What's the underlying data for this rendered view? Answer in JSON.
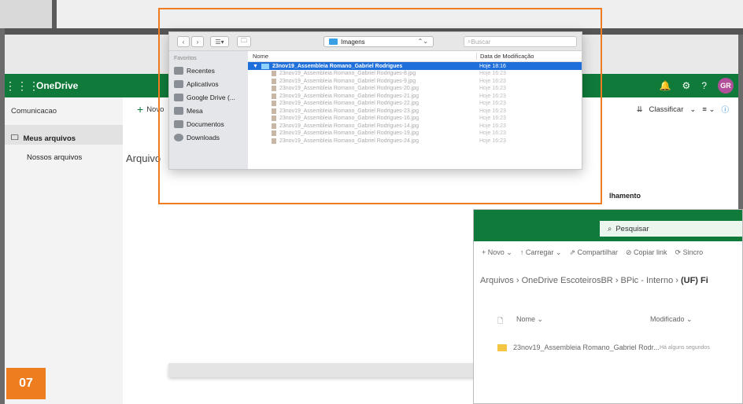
{
  "onedrive": {
    "brand": "OneDrive",
    "avatar_initials": "GR",
    "sidebar": {
      "title": "Comunicacao",
      "items": [
        {
          "label": "Meus arquivos"
        },
        {
          "label": "Nossos arquivos"
        }
      ]
    },
    "cmd": {
      "new_label": "Novo",
      "sort_label": "Classificar"
    },
    "files_title": "Arquivo",
    "detail_label": "lhamento"
  },
  "finder": {
    "location": "Imagens",
    "search_placeholder": "Buscar",
    "favorites_label": "Favoritos",
    "sidebar_items": [
      {
        "label": "Recentes"
      },
      {
        "label": "Aplicativos"
      },
      {
        "label": "Google Drive (..."
      },
      {
        "label": "Mesa"
      },
      {
        "label": "Documentos"
      },
      {
        "label": "Downloads"
      }
    ],
    "col_name": "Nome",
    "col_date": "Data de Modificação",
    "selected_folder": {
      "name": "23nov19_Assembleia Romano_Gabriel Rodrigues",
      "date": "Hoje 18:16"
    },
    "files": [
      {
        "name": "23nov19_Assembleia Romano_Gabriel Rodrigues-8.jpg",
        "date": "Hoje 16:23"
      },
      {
        "name": "23nov19_Assembleia Romano_Gabriel Rodrigues-9.jpg",
        "date": "Hoje 16:23"
      },
      {
        "name": "23nov19_Assembleia Romano_Gabriel Rodrigues-20.jpg",
        "date": "Hoje 16:23"
      },
      {
        "name": "23nov19_Assembleia Romano_Gabriel Rodrigues-21.jpg",
        "date": "Hoje 16:23"
      },
      {
        "name": "23nov19_Assembleia Romano_Gabriel Rodrigues-22.jpg",
        "date": "Hoje 16:23"
      },
      {
        "name": "23nov19_Assembleia Romano_Gabriel Rodrigues-23.jpg",
        "date": "Hoje 16:23"
      },
      {
        "name": "23nov19_Assembleia Romano_Gabriel Rodrigues-16.jpg",
        "date": "Hoje 16:23"
      },
      {
        "name": "23nov19_Assembleia Romano_Gabriel Rodrigues-14.jpg",
        "date": "Hoje 16:23"
      },
      {
        "name": "23nov19_Assembleia Romano_Gabriel Rodrigues-19.jpg",
        "date": "Hoje 16:23"
      },
      {
        "name": "23nov19_Assembleia Romano_Gabriel Rodrigues-24.jpg",
        "date": "Hoje 16:23"
      }
    ]
  },
  "inset": {
    "search_label": "Pesquisar",
    "cmd": {
      "new": "Novo",
      "upload": "Carregar",
      "share": "Compartilhar",
      "copy_link": "Copiar link",
      "sync": "Sincro"
    },
    "breadcrumb": {
      "p1": "Arquivos",
      "p2": "OneDrive EscoteirosBR",
      "p3": "BPic - Interno",
      "p4": "(UF) Fi"
    },
    "col_name": "Nome",
    "col_modified": "Modificado",
    "row": {
      "name": "23nov19_Assembleia Romano_Gabriel Rodr...",
      "modified": "Há alguns segundos"
    }
  },
  "badge": "07",
  "colors": {
    "onedrive_green": "#0f7a3a",
    "highlight_orange": "#f07c22",
    "finder_selection": "#1e6fdc"
  }
}
